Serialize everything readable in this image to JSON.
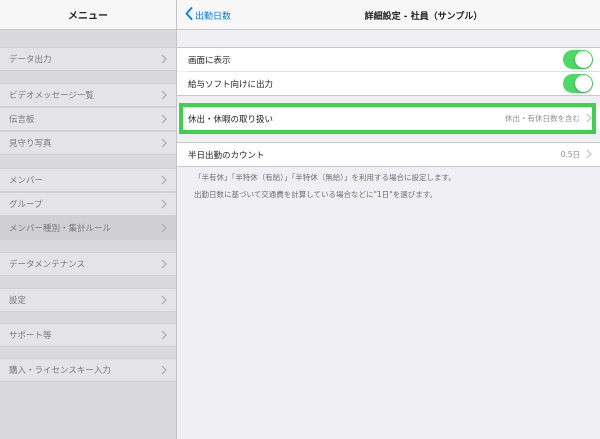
{
  "sidebar": {
    "title": "メニュー",
    "items": [
      {
        "label": "データ出力"
      },
      {
        "label": "ビデオメッセージ一覧"
      },
      {
        "label": "伝言板"
      },
      {
        "label": "見守り写真"
      },
      {
        "label": "メンバー"
      },
      {
        "label": "グループ"
      },
      {
        "label": "メンバー種別・集計ルール",
        "selected": true
      },
      {
        "label": "データメンテナンス"
      },
      {
        "label": "設定"
      },
      {
        "label": "サポート等"
      },
      {
        "label": "購入・ライセンスキー入力"
      }
    ]
  },
  "navbar": {
    "back_label": "出勤日数",
    "title": "詳細設定 - 社員（サンプル）"
  },
  "settings": {
    "show_on_screen": {
      "label": "画面に表示",
      "enabled": true
    },
    "payroll_output": {
      "label": "給与ソフト向けに出力",
      "enabled": true
    },
    "leave_handling": {
      "label": "休出・休暇の取り扱い",
      "value": "休出・有休日数を含む"
    },
    "half_day": {
      "label": "半日出勤のカウント",
      "value": "0.5日"
    }
  },
  "footnotes": {
    "line1": "「半有休」「半特休（有給）」「半特休（無給）」を利用する場合に設定します。",
    "line2": "出勤日数に基づいて交通費を計算している場合などに\"1日\"を選びます。"
  },
  "colors": {
    "accent": "#007aff",
    "toggle_on": "#4cd964",
    "highlight": "#3cd24c"
  }
}
